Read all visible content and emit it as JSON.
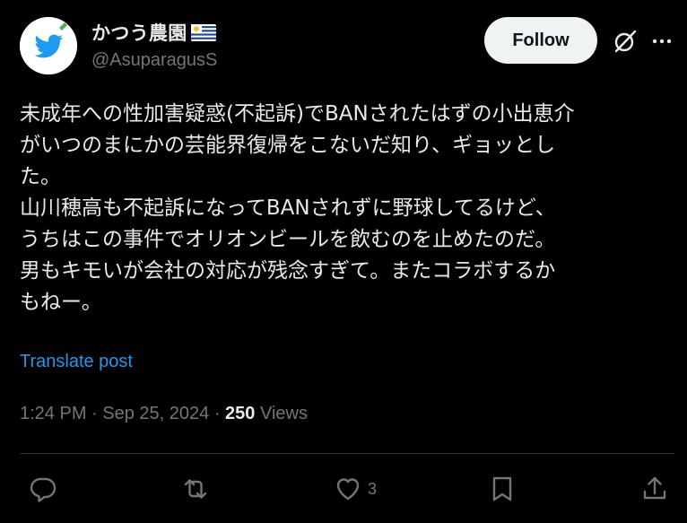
{
  "author": {
    "display_name": "かつう農園",
    "handle": "@AsuparagusS",
    "flag_icon": "uruguay-flag-icon",
    "avatar_icon": "bird-avatar-icon"
  },
  "header": {
    "follow_label": "Follow",
    "grok_icon": "slashed-circle-icon",
    "more_icon": "more-dots-icon"
  },
  "post": {
    "text": "未成年への性加害疑惑(不起訴)でBANされたはずの小出恵介\nがいつのまにかの芸能界復帰をこないだ知り、ギョッとし\nた。\n山川穂高も不起訴になってBANされずに野球してるけど、\nうちはこの事件でオリオンビールを飲むのを止めたのだ。\n男もキモいが会社の対応が残念すぎて。またコラボするか\nもねー。",
    "translate_label": "Translate post"
  },
  "meta": {
    "time": "1:24 PM",
    "date": "Sep 25, 2024",
    "sep1": " · ",
    "sep2": " · ",
    "views_count": "250",
    "views_label": " Views"
  },
  "actions": {
    "reply_icon": "reply-icon",
    "repost_icon": "repost-icon",
    "like_icon": "heart-icon",
    "like_count": "3",
    "bookmark_icon": "bookmark-icon",
    "share_icon": "share-icon"
  },
  "colors": {
    "background": "#000000",
    "text": "#e7e9ea",
    "muted": "#71767b",
    "accent": "#1d9bf0",
    "follow_bg": "#eff3f4",
    "divider": "#2f3336"
  }
}
